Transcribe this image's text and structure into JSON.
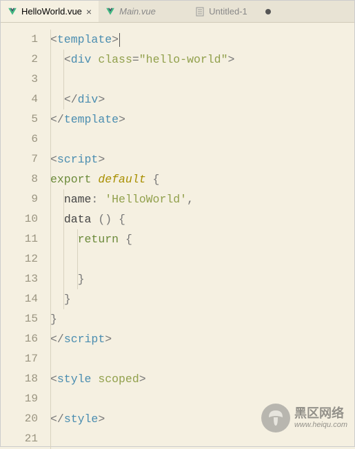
{
  "tabs": [
    {
      "label": "HelloWorld.vue",
      "icon": "vue",
      "active": true,
      "indicator": "close"
    },
    {
      "label": "Main.vue",
      "icon": "vue",
      "active": false,
      "italic": true,
      "indicator": "none"
    },
    {
      "label": "Untitled-1",
      "icon": "file",
      "active": false,
      "indicator": "dot"
    }
  ],
  "code": {
    "lines": [
      {
        "n": 1,
        "indent": 0,
        "tokens": [
          [
            "punc",
            "<"
          ],
          [
            "tagname",
            "template"
          ],
          [
            "punc",
            ">"
          ],
          [
            "cursor",
            ""
          ]
        ]
      },
      {
        "n": 2,
        "indent": 2,
        "tokens": [
          [
            "punc",
            "<"
          ],
          [
            "tagname",
            "div"
          ],
          [
            "plain",
            " "
          ],
          [
            "attr",
            "class"
          ],
          [
            "punc",
            "="
          ],
          [
            "str",
            "\"hello-world\""
          ],
          [
            "punc",
            ">"
          ]
        ]
      },
      {
        "n": 3,
        "indent": 0,
        "tokens": []
      },
      {
        "n": 4,
        "indent": 2,
        "tokens": [
          [
            "punc",
            "</"
          ],
          [
            "tagname",
            "div"
          ],
          [
            "punc",
            ">"
          ]
        ]
      },
      {
        "n": 5,
        "indent": 0,
        "tokens": [
          [
            "punc",
            "</"
          ],
          [
            "tagname",
            "template"
          ],
          [
            "punc",
            ">"
          ]
        ]
      },
      {
        "n": 6,
        "indent": 0,
        "tokens": []
      },
      {
        "n": 7,
        "indent": 0,
        "tokens": [
          [
            "punc",
            "<"
          ],
          [
            "tagname",
            "script"
          ],
          [
            "punc",
            ">"
          ]
        ]
      },
      {
        "n": 8,
        "indent": 0,
        "tokens": [
          [
            "kw-export",
            "export"
          ],
          [
            "plain",
            " "
          ],
          [
            "kw-default",
            "default"
          ],
          [
            "plain",
            " "
          ],
          [
            "punc",
            "{"
          ]
        ]
      },
      {
        "n": 9,
        "indent": 2,
        "tokens": [
          [
            "prop",
            "name"
          ],
          [
            "punc",
            ":"
          ],
          [
            "plain",
            " "
          ],
          [
            "strlit",
            "'HelloWorld'"
          ],
          [
            "punc",
            ","
          ]
        ]
      },
      {
        "n": 10,
        "indent": 2,
        "tokens": [
          [
            "prop",
            "data"
          ],
          [
            "plain",
            " "
          ],
          [
            "punc",
            "()"
          ],
          [
            "plain",
            " "
          ],
          [
            "punc",
            "{"
          ]
        ]
      },
      {
        "n": 11,
        "indent": 4,
        "tokens": [
          [
            "kw-return",
            "return"
          ],
          [
            "plain",
            " "
          ],
          [
            "punc",
            "{"
          ]
        ]
      },
      {
        "n": 12,
        "indent": 0,
        "tokens": []
      },
      {
        "n": 13,
        "indent": 4,
        "tokens": [
          [
            "punc",
            "}"
          ]
        ]
      },
      {
        "n": 14,
        "indent": 2,
        "tokens": [
          [
            "punc",
            "}"
          ]
        ]
      },
      {
        "n": 15,
        "indent": 0,
        "tokens": [
          [
            "punc",
            "}"
          ]
        ]
      },
      {
        "n": 16,
        "indent": 0,
        "tokens": [
          [
            "punc",
            "</"
          ],
          [
            "tagname",
            "script"
          ],
          [
            "punc",
            ">"
          ]
        ]
      },
      {
        "n": 17,
        "indent": 0,
        "tokens": []
      },
      {
        "n": 18,
        "indent": 0,
        "tokens": [
          [
            "punc",
            "<"
          ],
          [
            "tagname",
            "style"
          ],
          [
            "plain",
            " "
          ],
          [
            "kw-scoped",
            "scoped"
          ],
          [
            "punc",
            ">"
          ]
        ]
      },
      {
        "n": 19,
        "indent": 0,
        "tokens": []
      },
      {
        "n": 20,
        "indent": 0,
        "tokens": [
          [
            "punc",
            "</"
          ],
          [
            "tagname",
            "style"
          ],
          [
            "punc",
            ">"
          ]
        ]
      },
      {
        "n": 21,
        "indent": 0,
        "tokens": []
      }
    ]
  },
  "watermark": {
    "title": "黑区网络",
    "subtitle": "www.heiqu.com"
  }
}
